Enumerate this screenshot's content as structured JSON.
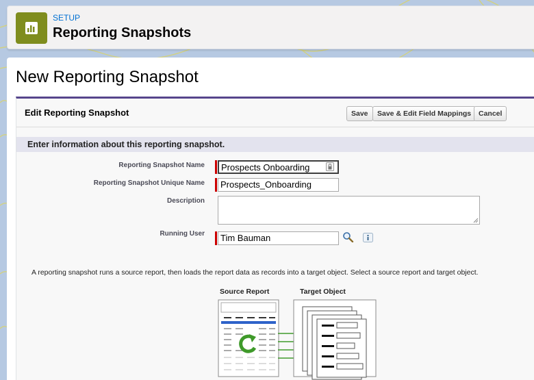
{
  "header": {
    "eyebrow": "SETUP",
    "title": "Reporting Snapshots",
    "icon": "report-icon"
  },
  "page": {
    "title": "New Reporting Snapshot"
  },
  "edit_block": {
    "title": "Edit Reporting Snapshot",
    "buttons": {
      "save": "Save",
      "save_edit_mappings": "Save & Edit Field Mappings",
      "cancel": "Cancel"
    },
    "section_heading": "Enter information about this reporting snapshot."
  },
  "form": {
    "name": {
      "label": "Reporting Snapshot Name",
      "value": "Prospects Onboarding",
      "required": true
    },
    "unique_name": {
      "label": "Reporting Snapshot Unique Name",
      "value": "Prospects_Onboarding",
      "required": true
    },
    "description": {
      "label": "Description",
      "value": ""
    },
    "running_user": {
      "label": "Running User",
      "value": "Tim Bauman",
      "required": true,
      "lookup_icon": "lookup-magnifier-icon",
      "info_icon": "info-icon"
    }
  },
  "help": {
    "text": "A reporting snapshot runs a source report, then loads the report data as records into a target object. Select a source report and target object."
  },
  "diagram": {
    "source_label": "Source Report",
    "target_label": "Target Object"
  },
  "colors": {
    "accent_purple": "#56458c",
    "header_icon_bg": "#7f8d1e",
    "link_blue": "#0070d2",
    "required_red": "#cc0000",
    "refresh_green": "#4fa32e"
  }
}
